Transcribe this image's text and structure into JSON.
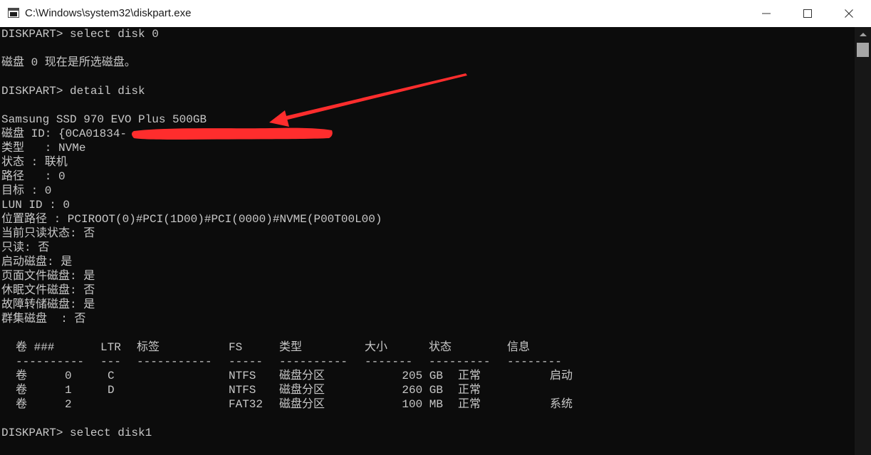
{
  "window": {
    "title": "C:\\Windows\\system32\\diskpart.exe"
  },
  "console": {
    "lines": [
      "DISKPART> select disk 0",
      "",
      "磁盘 0 现在是所选磁盘。",
      "",
      "DISKPART> detail disk",
      "",
      "Samsung SSD 970 EVO Plus 500GB",
      "磁盘 ID: {0CA01834-",
      "类型   : NVMe",
      "状态 : 联机",
      "路径   : 0",
      "目标 : 0",
      "LUN ID : 0",
      "位置路径 : PCIROOT(0)#PCI(1D00)#PCI(0000)#NVME(P00T00L00)",
      "当前只读状态: 否",
      "只读: 否",
      "启动磁盘: 是",
      "页面文件磁盘: 是",
      "休眠文件磁盘: 否",
      "故障转储磁盘: 是",
      "群集磁盘  : 否"
    ],
    "volume_table": {
      "headers": [
        "卷 ###",
        "LTR",
        "标签",
        "FS",
        "类型",
        "大小",
        "状态",
        "信息"
      ],
      "separators": [
        "----------",
        "---",
        "-----------",
        "-----",
        "----------",
        "-------",
        "---------",
        "--------"
      ],
      "rows": [
        [
          "卷",
          "0",
          "C",
          "",
          "NTFS",
          "磁盘分区",
          "205 GB",
          "正常",
          "启动"
        ],
        [
          "卷",
          "1",
          "D",
          "",
          "NTFS",
          "磁盘分区",
          "260 GB",
          "正常",
          ""
        ],
        [
          "卷",
          "2",
          "",
          "",
          "FAT32",
          "磁盘分区",
          "100 MB",
          "正常",
          "系统"
        ]
      ]
    },
    "last_command": "DISKPART> select disk1"
  },
  "colors": {
    "background": "#0c0c0c",
    "text": "#c8c8c8",
    "titlebar": "#ffffff",
    "annotation": "#ff2d2d"
  }
}
